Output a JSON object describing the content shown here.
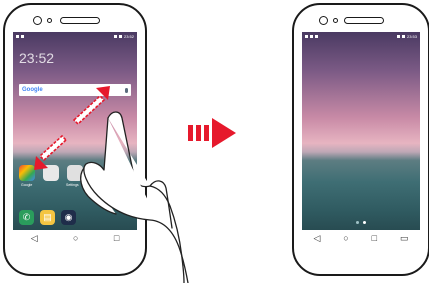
{
  "left_screen": {
    "clock": "23:52",
    "status_time": "23:52",
    "search": {
      "brand": "Google"
    },
    "app_labels": [
      "Google",
      "",
      "Settings",
      ""
    ],
    "nav": [
      "◁",
      "○",
      "□"
    ]
  },
  "right_screen": {
    "status_time": "23:53",
    "nav": [
      "◁",
      "○",
      "□",
      "▭"
    ]
  },
  "colors": {
    "arrow_red": "#e6192c",
    "phone_outline": "#1a1a1a"
  }
}
